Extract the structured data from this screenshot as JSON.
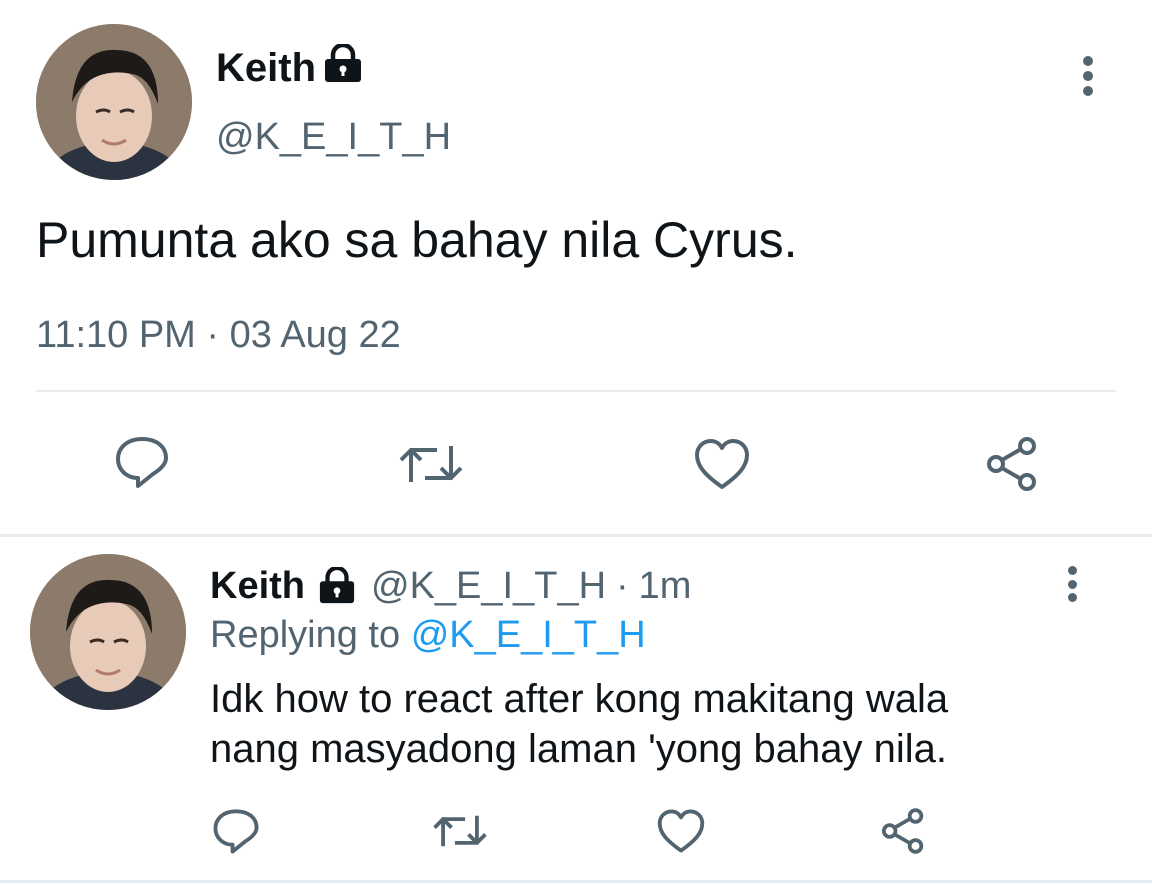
{
  "main_tweet": {
    "display_name": "Keith",
    "handle": "@K_E_I_T_H",
    "text": "Pumunta ako sa bahay nila Cyrus.",
    "timestamp": "11:10 PM · 03 Aug 22",
    "icons": [
      "lock-icon",
      "more-vertical-icon",
      "reply-icon",
      "retweet-icon",
      "like-icon",
      "share-icon"
    ]
  },
  "reply_tweet": {
    "display_name": "Keith",
    "handle": "@K_E_I_T_H",
    "separator": "·",
    "time_ago": "1m",
    "replying_prefix": "Replying to",
    "replying_handle": "@K_E_I_T_H",
    "text": "Idk how to react after kong makitang wala nang masyadong laman 'yong bahay nila."
  },
  "colors": {
    "text": "#0f1419",
    "muted": "#536471",
    "link": "#1d9bf0",
    "divider": "#e6ecf0"
  }
}
